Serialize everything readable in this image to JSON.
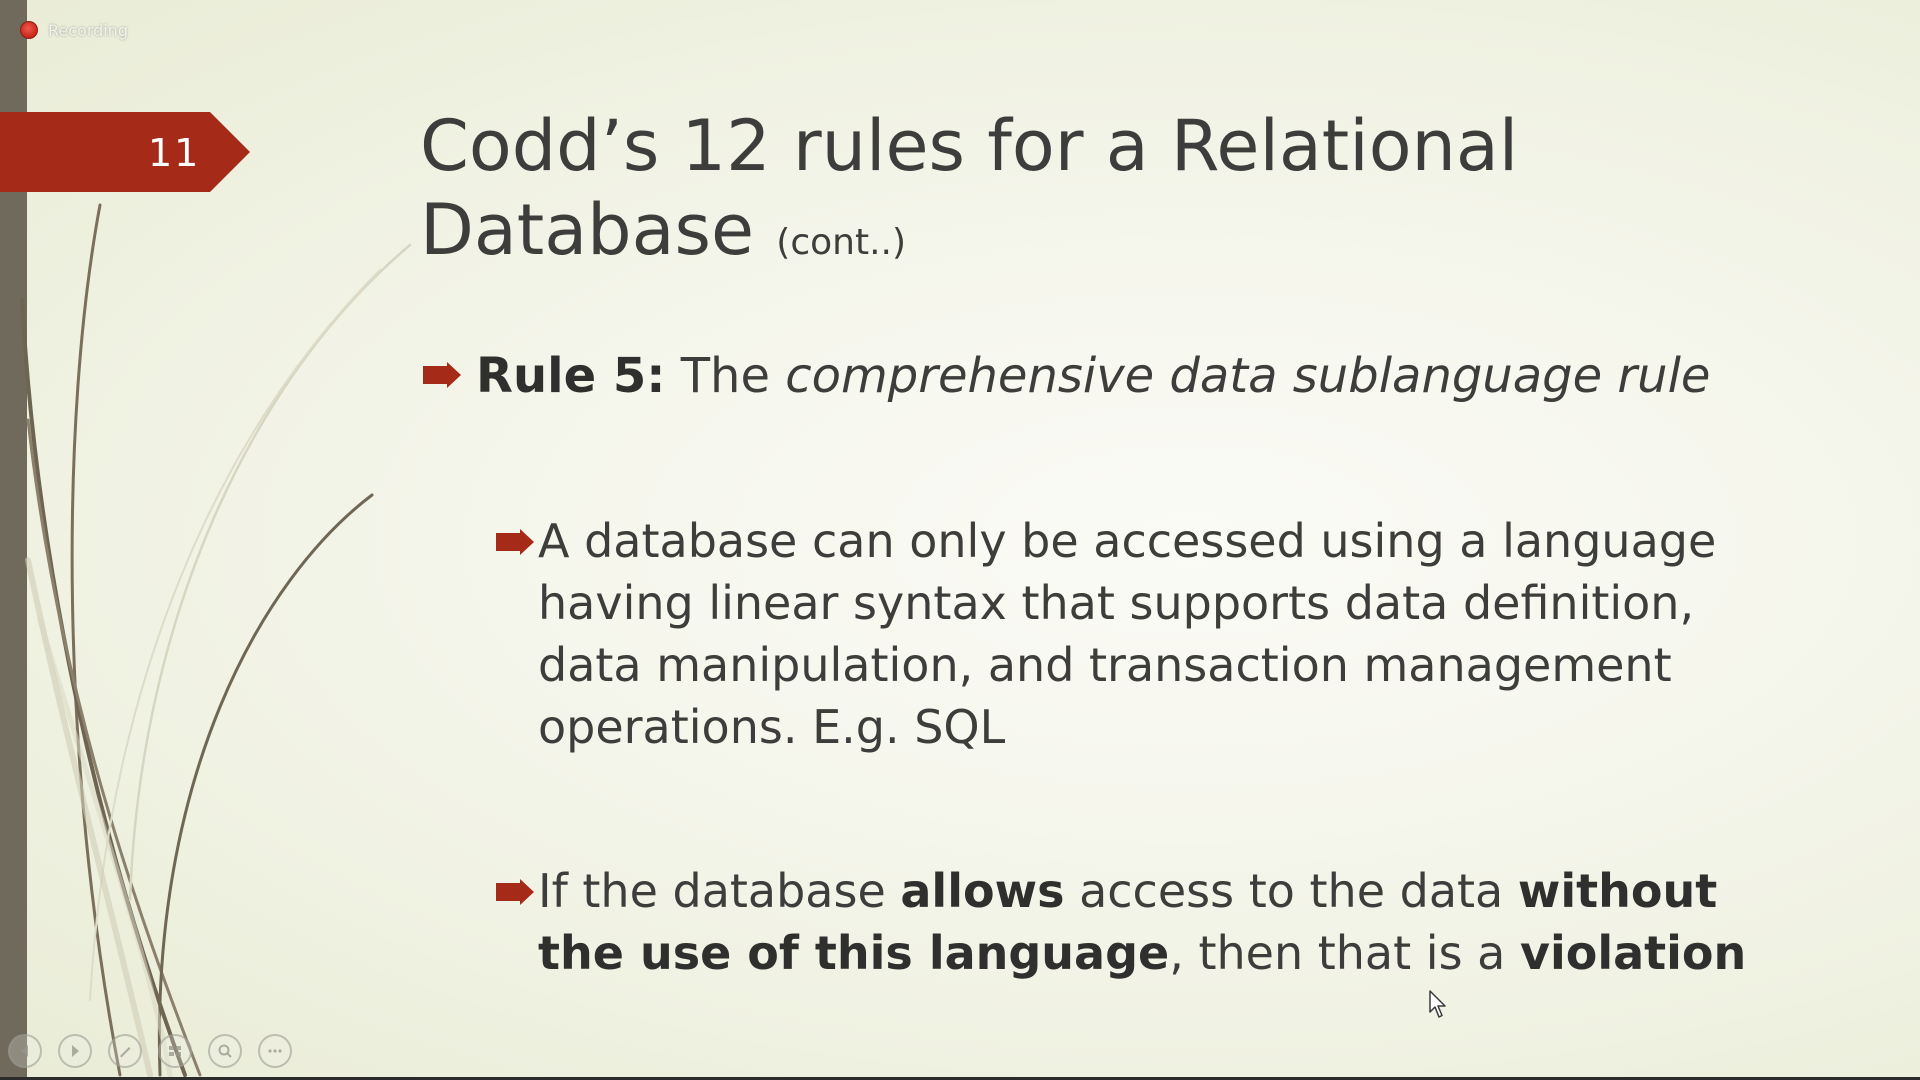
{
  "recording": {
    "label": "Recording",
    "color": "#d32f22"
  },
  "slide": {
    "number": "11",
    "title_main": "Codd’s 12 rules for a Relational Database",
    "title_suffix": "(cont..)",
    "accent_color": "#a52a17",
    "bullets": [
      {
        "level": 1,
        "segments": [
          {
            "text": "Rule 5:",
            "style": "bold"
          },
          {
            "text": " The ",
            "style": "normal"
          },
          {
            "text": "comprehensive data sublanguage rule",
            "style": "italic"
          }
        ]
      },
      {
        "level": 2,
        "segments": [
          {
            "text": "A database can only be accessed using a language having linear syntax that supports data definition, data manipulation, and transaction management operations. E.g. SQL",
            "style": "normal"
          }
        ]
      },
      {
        "level": 2,
        "segments": [
          {
            "text": "If the database ",
            "style": "normal"
          },
          {
            "text": "allows",
            "style": "bold"
          },
          {
            "text": " access to the data ",
            "style": "normal"
          },
          {
            "text": "without the use of this language",
            "style": "bold"
          },
          {
            "text": ", then that is a ",
            "style": "normal"
          },
          {
            "text": "violation",
            "style": "bold"
          }
        ]
      }
    ]
  },
  "presenter_toolbar": {
    "buttons": [
      "previous-icon",
      "next-icon",
      "pen-icon",
      "slides-grid-icon",
      "zoom-icon",
      "more-options-icon"
    ]
  }
}
